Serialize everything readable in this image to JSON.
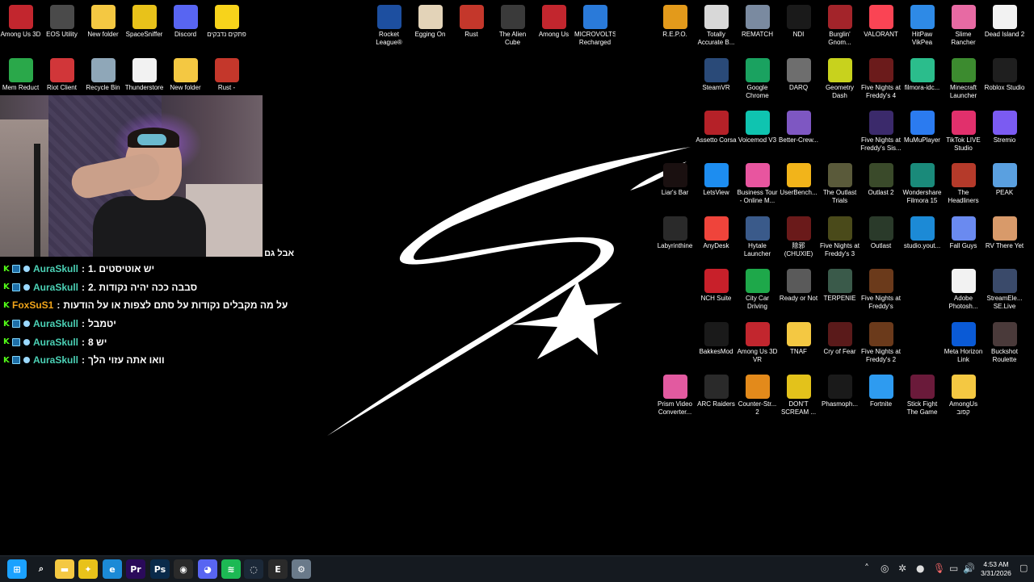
{
  "desktop_icons": [
    {
      "label": "Among Us 3D",
      "icon": "among-us-3d-icon",
      "color": "#c2262e"
    },
    {
      "label": "EOS Utility",
      "icon": "eos-utility-icon",
      "color": "#4a4a4a"
    },
    {
      "label": "New folder",
      "icon": "folder-icon",
      "color": "#f4c842"
    },
    {
      "label": "SpaceSniffer",
      "icon": "spacesniffer-icon",
      "color": "#e8c21a"
    },
    {
      "label": "Discord",
      "icon": "discord-icon",
      "color": "#5865f2"
    },
    {
      "label": "פתקים נדבקים",
      "icon": "sticky-notes-icon",
      "color": "#f7d31b"
    },
    {
      "label": "Mem Reduct",
      "icon": "mem-reduct-icon",
      "color": "#2aa84a"
    },
    {
      "label": "Riot Client",
      "icon": "riot-client-icon",
      "color": "#d13639"
    },
    {
      "label": "Recycle Bin",
      "icon": "recycle-bin-icon",
      "color": "#8fa7b8"
    },
    {
      "label": "Thunderstore",
      "icon": "file-icon",
      "color": "#f2f2f2"
    },
    {
      "label": "New folder",
      "icon": "folder-icon",
      "color": "#f4c842"
    },
    {
      "label": "Rust -",
      "icon": "rust-icon",
      "color": "#c4372b"
    },
    {
      "label": "Rocket League®",
      "icon": "rocket-league-icon",
      "color": "#1d4fa0"
    },
    {
      "label": "Egging On",
      "icon": "egg-icon",
      "color": "#e3d3b8"
    },
    {
      "label": "Rust",
      "icon": "rust-icon",
      "color": "#c4372b"
    },
    {
      "label": "The Alien Cube",
      "icon": "alien-cube-icon",
      "color": "#3a3a3a"
    },
    {
      "label": "Among Us",
      "icon": "among-us-icon",
      "color": "#c2262e"
    },
    {
      "label": "MICROVOLTS Recharged",
      "icon": "microvolts-icon",
      "color": "#2a7ad9"
    },
    {
      "label": "R.E.P.O.",
      "icon": "repo-icon",
      "color": "#e39a1b"
    },
    {
      "label": "Totally Accurate B...",
      "icon": "tabs-icon",
      "color": "#d8d8d8"
    },
    {
      "label": "REMATCH",
      "icon": "rematch-icon",
      "color": "#7a8aa0"
    },
    {
      "label": "NDI",
      "icon": "ndi-icon",
      "color": "#1a1a1a"
    },
    {
      "label": "Burglin' Gnom...",
      "icon": "burglin-gnomes-icon",
      "color": "#a3242a"
    },
    {
      "label": "VALORANT",
      "icon": "valorant-icon",
      "color": "#fa4454"
    },
    {
      "label": "HitPaw VikPea",
      "icon": "hitpaw-icon",
      "color": "#2e8ae6"
    },
    {
      "label": "Slime Rancher",
      "icon": "slime-rancher-icon",
      "color": "#e76aa3"
    },
    {
      "label": "Dead Island 2",
      "icon": "file-icon",
      "color": "#f2f2f2"
    },
    {
      "label": "SteamVR",
      "icon": "steamvr-icon",
      "color": "#2a4a78"
    },
    {
      "label": "Google Chrome",
      "icon": "chrome-icon",
      "color": "#1aa260"
    },
    {
      "label": "DARQ",
      "icon": "darq-icon",
      "color": "#6e6e6e"
    },
    {
      "label": "Geometry Dash",
      "icon": "geometry-dash-icon",
      "color": "#c8d21d"
    },
    {
      "label": "Five Nights at Freddy's 4",
      "icon": "fnaf-icon",
      "color": "#6b1b1b"
    },
    {
      "label": "filmora-idc...",
      "icon": "filmora-icon",
      "color": "#2bbd8c"
    },
    {
      "label": "Minecraft Launcher",
      "icon": "minecraft-icon",
      "color": "#3c8b2f"
    },
    {
      "label": "Roblox Studio",
      "icon": "roblox-studio-icon",
      "color": "#1f1f1f"
    },
    {
      "label": "Assetto Corsa",
      "icon": "assetto-corsa-icon",
      "color": "#b52128"
    },
    {
      "label": "Voicemod V3",
      "icon": "voicemod-icon",
      "color": "#0fc4b0"
    },
    {
      "label": "Better-Crew...",
      "icon": "better-crewlink-icon",
      "color": "#7e57c2"
    },
    {
      "label": "Five Nights at Freddy's Sis...",
      "icon": "fnaf-sister-location-icon",
      "color": "#3b2a6b"
    },
    {
      "label": "MuMuPlayer",
      "icon": "mumuplayer-icon",
      "color": "#2b7bf0"
    },
    {
      "label": "TikTok LIVE Studio",
      "icon": "tiktok-icon",
      "color": "#e1306c"
    },
    {
      "label": "Stremio",
      "icon": "stremio-icon",
      "color": "#7b5bf2"
    },
    {
      "label": "Liar's Bar",
      "icon": "liars-bar-icon",
      "color": "#1a1010"
    },
    {
      "label": "LetsView",
      "icon": "letsview-icon",
      "color": "#1d8df0"
    },
    {
      "label": "Business Tour - Online M...",
      "icon": "business-tour-icon",
      "color": "#e8559f"
    },
    {
      "label": "UserBench...",
      "icon": "userbenchmark-icon",
      "color": "#f2b41a"
    },
    {
      "label": "The Outlast Trials",
      "icon": "outlast-trials-icon",
      "color": "#5a5a3a"
    },
    {
      "label": "Outlast 2",
      "icon": "outlast-2-icon",
      "color": "#3a4a2a"
    },
    {
      "label": "Wondershare Filmora 15",
      "icon": "filmora-icon",
      "color": "#1a8a7a"
    },
    {
      "label": "The Headliners",
      "icon": "headliners-icon",
      "color": "#b53a2a"
    },
    {
      "label": "PEAK",
      "icon": "peak-icon",
      "color": "#5aa0e0"
    },
    {
      "label": "Labyrinthine",
      "icon": "labyrinthine-icon",
      "color": "#2a2a2a"
    },
    {
      "label": "AnyDesk",
      "icon": "anydesk-icon",
      "color": "#ef443b"
    },
    {
      "label": "Hytale Launcher",
      "icon": "hytale-icon",
      "color": "#3a5a8a"
    },
    {
      "label": "除邪 (CHUXIE)",
      "icon": "chuxie-icon",
      "color": "#6a1a1a"
    },
    {
      "label": "Five Nights at Freddy's 3",
      "icon": "fnaf-3-icon",
      "color": "#4a4a1a"
    },
    {
      "label": "Outlast",
      "icon": "outlast-icon",
      "color": "#2a3a2a"
    },
    {
      "label": "studio.yout...",
      "icon": "edge-icon",
      "color": "#1c8ad6"
    },
    {
      "label": "Fall Guys",
      "icon": "fall-guys-icon",
      "color": "#6a8af0"
    },
    {
      "label": "RV There Yet",
      "icon": "rv-there-yet-icon",
      "color": "#d89a6a"
    },
    {
      "label": "NCH Suite",
      "icon": "nch-suite-icon",
      "color": "#c8202a"
    },
    {
      "label": "City Car Driving",
      "icon": "city-car-driving-icon",
      "color": "#1ea84a"
    },
    {
      "label": "Ready or Not",
      "icon": "ready-or-not-icon",
      "color": "#5a5a5a"
    },
    {
      "label": "TERPENIE",
      "icon": "terpenie-icon",
      "color": "#3a5a4a"
    },
    {
      "label": "Five Nights at Freddy's",
      "icon": "fnaf-icon",
      "color": "#6b3a1b"
    },
    {
      "label": "Adobe Photosh...",
      "icon": "file-icon",
      "color": "#f2f2f2"
    },
    {
      "label": "StreamEle... SE.Live",
      "icon": "streamelements-icon",
      "color": "#3a4a6a"
    },
    {
      "label": "BakkesMod",
      "icon": "bakkesmod-icon",
      "color": "#1a1a1a"
    },
    {
      "label": "Among Us 3D VR",
      "icon": "among-us-vr-icon",
      "color": "#c2262e"
    },
    {
      "label": "TNAF",
      "icon": "folder-icon",
      "color": "#f4c842"
    },
    {
      "label": "Cry of Fear",
      "icon": "cry-of-fear-icon",
      "color": "#5a1a1a"
    },
    {
      "label": "Five Nights at Freddy's 2",
      "icon": "fnaf-2-icon",
      "color": "#6b3a1b"
    },
    {
      "label": "Meta Horizon Link",
      "icon": "meta-icon",
      "color": "#0a5ad6"
    },
    {
      "label": "Buckshot Roulette",
      "icon": "buckshot-roulette-icon",
      "color": "#4a3a3a"
    },
    {
      "label": "Prism Video Converter...",
      "icon": "prism-icon",
      "color": "#e25aa0"
    },
    {
      "label": "ARC Raiders",
      "icon": "arc-raiders-icon",
      "color": "#2a2a2a"
    },
    {
      "label": "Counter-Str... 2",
      "icon": "cs2-icon",
      "color": "#e38a1b"
    },
    {
      "label": "DON'T SCREAM ...",
      "icon": "dont-scream-icon",
      "color": "#e3c21b"
    },
    {
      "label": "Phasmoph...",
      "icon": "phasmophobia-icon",
      "color": "#1a1a1a"
    },
    {
      "label": "Fortnite",
      "icon": "fortnite-icon",
      "color": "#2e9bf0"
    },
    {
      "label": "Stick Fight The Game",
      "icon": "stick-fight-icon",
      "color": "#6a1a3a"
    },
    {
      "label": "AmongUs קפוב",
      "icon": "folder-icon",
      "color": "#f4c842"
    }
  ],
  "chat": {
    "top_line": "אבל גם",
    "messages": [
      {
        "user": "AuraSkull",
        "user_color": "#4bd1b5",
        "text": "יש אוטיסטים .1"
      },
      {
        "user": "AuraSkull",
        "user_color": "#4bd1b5",
        "text": "סבבה ככה יהיה נקודות .2"
      },
      {
        "user": "FoxSuS1",
        "user_color": "#f2a51a",
        "text": "על מה מקבלים נקודות על סתם לצפות או על הודעות"
      },
      {
        "user": "AuraSkull",
        "user_color": "#4bd1b5",
        "text": "יטמבל"
      },
      {
        "user": "AuraSkull",
        "user_color": "#4bd1b5",
        "text": "יש 8"
      },
      {
        "user": "AuraSkull",
        "user_color": "#4bd1b5",
        "text": "וואו אתה עזוי הלך"
      }
    ]
  },
  "taskbar": {
    "pinned": [
      {
        "icon": "start-icon",
        "color": "#1ba1ff"
      },
      {
        "icon": "search-icon",
        "color": "#ffffff"
      },
      {
        "icon": "file-explorer-icon",
        "color": "#f4c842"
      },
      {
        "icon": "spacesniffer-icon",
        "color": "#e8c21a"
      },
      {
        "icon": "edge-icon",
        "color": "#1c8ad6"
      },
      {
        "icon": "premiere-pro-icon",
        "color": "#2a0a5a"
      },
      {
        "icon": "photoshop-icon",
        "color": "#0a2a4a"
      },
      {
        "icon": "obs-icon",
        "color": "#2a2a2a"
      },
      {
        "icon": "discord-icon",
        "color": "#5865f2"
      },
      {
        "icon": "spotify-icon",
        "color": "#1db954"
      },
      {
        "icon": "steam-icon",
        "color": "#1b2838"
      },
      {
        "icon": "epic-games-icon",
        "color": "#2a2a2a"
      },
      {
        "icon": "settings-icon",
        "color": "#6a7a8a"
      }
    ],
    "tray": {
      "time": "4:53 AM",
      "date": "3/31/2026"
    }
  }
}
